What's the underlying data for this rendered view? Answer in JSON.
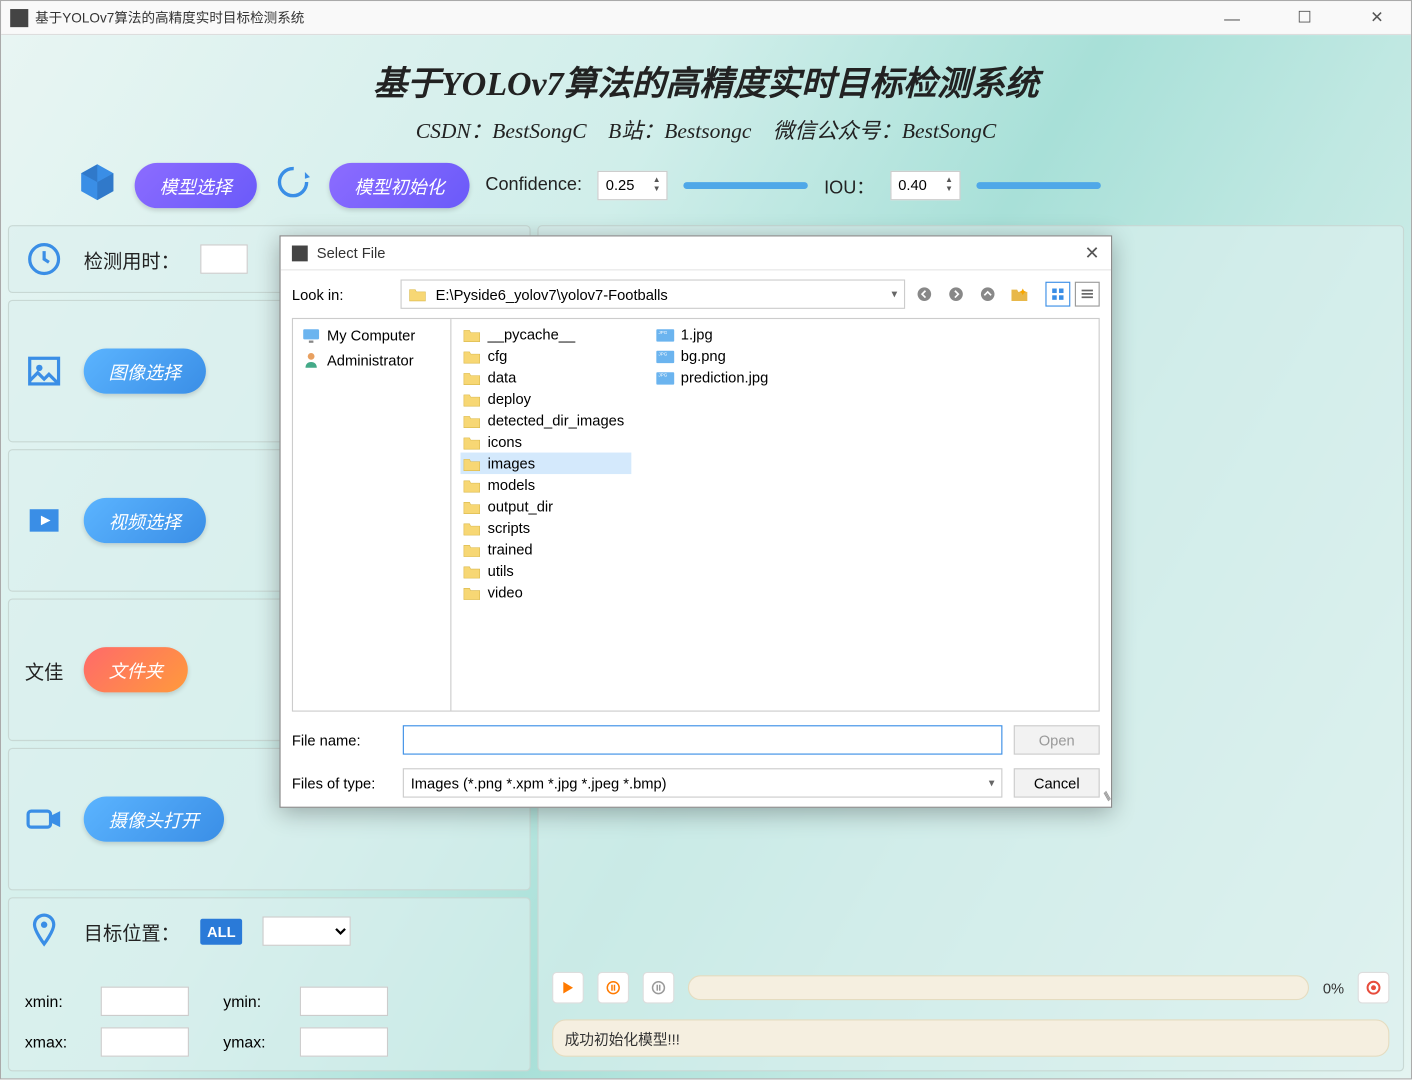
{
  "window": {
    "title": "基于YOLOv7算法的高精度实时目标检测系统",
    "minimize": "—",
    "maximize": "☐",
    "close": "✕"
  },
  "header": {
    "title": "基于YOLOv7算法的高精度实时目标检测系统",
    "subtitle": "CSDN：BestSongC　B站：Bestsongc　微信公众号：BestSongC"
  },
  "toolbar": {
    "model_select": "模型选择",
    "model_init": "模型初始化",
    "confidence_label": "Confidence:",
    "confidence_value": "0.25",
    "iou_label": "IOU：",
    "iou_value": "0.40"
  },
  "sidebar": {
    "detect_time_label": "检测用时：",
    "detect_time_value": "",
    "image_select": "图像选择",
    "video_select": "视频选择",
    "wenjia_label": "文佳",
    "folder_btn": "文件夹",
    "camera_open": "摄像头打开",
    "target_pos_label": "目标位置：",
    "all_badge": "ALL",
    "xmin": "xmin:",
    "ymin": "ymin:",
    "xmax": "xmax:",
    "ymax": "ymax:"
  },
  "transport": {
    "percent": "0%"
  },
  "status": "成功初始化模型!!!",
  "dialog": {
    "title": "Select File",
    "lookin_label": "Look in:",
    "lookin_path": "E:\\Pyside6_yolov7\\yolov7-Footballs",
    "tree": {
      "my_computer": "My Computer",
      "administrator": "Administrator"
    },
    "folders": [
      "__pycache__",
      "cfg",
      "data",
      "deploy",
      "detected_dir_images",
      "icons",
      "images",
      "models",
      "output_dir",
      "scripts",
      "trained",
      "utils",
      "video"
    ],
    "selected_folder": "images",
    "images": [
      "1.jpg",
      "bg.png",
      "prediction.jpg"
    ],
    "filename_label": "File name:",
    "filename_value": "",
    "filetype_label": "Files of type:",
    "filetype_value": "Images (*.png *.xpm *.jpg *.jpeg *.bmp)",
    "open": "Open",
    "cancel": "Cancel"
  }
}
